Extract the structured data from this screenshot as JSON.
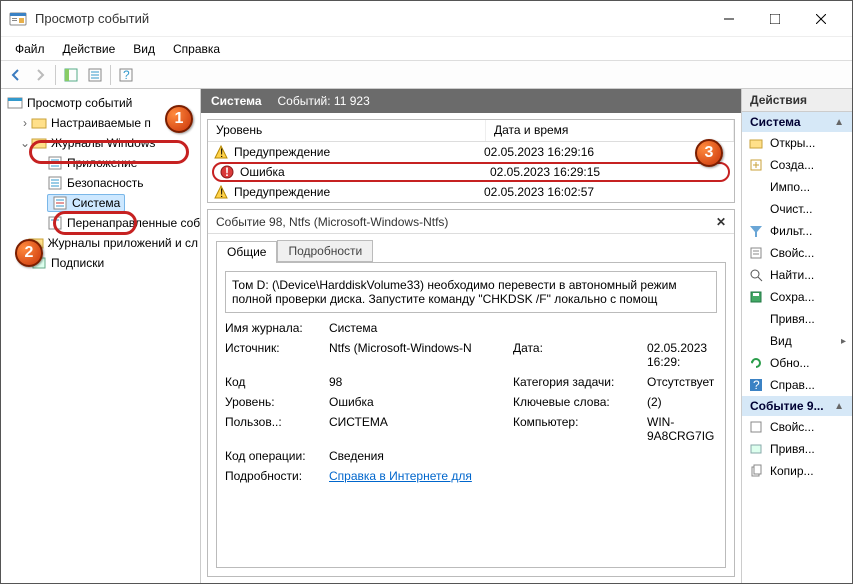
{
  "window": {
    "title": "Просмотр событий"
  },
  "menu": {
    "file": "Файл",
    "action": "Действие",
    "view": "Вид",
    "help": "Справка"
  },
  "tree": {
    "root": "Просмотр событий",
    "custom": "Настраиваемые п",
    "winlogs": "Журналы Windows",
    "app": "Приложение",
    "security": "Безопасность",
    "system": "Система",
    "forwarded": "Перенаправленные соб",
    "applogs": "Журналы приложений и сл",
    "subs": "Подписки"
  },
  "center": {
    "title": "Система",
    "count_label": "Событий: 11 923",
    "col_level": "Уровень",
    "col_date": "Дата и время",
    "rows": [
      {
        "level": "Предупреждение",
        "date": "02.05.2023 16:29:16",
        "type": "warn"
      },
      {
        "level": "Ошибка",
        "date": "02.05.2023 16:29:15",
        "type": "error"
      },
      {
        "level": "Предупреждение",
        "date": "02.05.2023 16:02:57",
        "type": "warn"
      }
    ],
    "detail_title": "Событие 98, Ntfs (Microsoft-Windows-Ntfs)",
    "tab_general": "Общие",
    "tab_details": "Подробности",
    "message": "Том D: (\\Device\\HarddiskVolume33) необходимо перевести в автономный режим полной проверки диска. Запустите команду \"CHKDSK /F\" локально с помощ",
    "props": {
      "log_lbl": "Имя журнала:",
      "log_val": "Система",
      "src_lbl": "Источник:",
      "src_val": "Ntfs (Microsoft-Windows-N",
      "date_lbl": "Дата:",
      "date_val": "02.05.2023 16:29:",
      "code_lbl": "Код",
      "code_val": "98",
      "cat_lbl": "Категория задачи:",
      "cat_val": "Отсутствует",
      "lvl_lbl": "Уровень:",
      "lvl_val": "Ошибка",
      "kw_lbl": "Ключевые слова:",
      "kw_val": "(2)",
      "user_lbl": "Пользов..:",
      "user_val": "СИСТЕМА",
      "comp_lbl": "Компьютер:",
      "comp_val": "WIN-9A8CRG7IG",
      "op_lbl": "Код операции:",
      "op_val": "Сведения",
      "info_lbl": "Подробности:",
      "info_link": "Справка в Интернете для"
    }
  },
  "actions": {
    "header": "Действия",
    "sec1": "Система",
    "open": "Откры...",
    "create": "Созда...",
    "import": "Импо...",
    "clear": "Очист...",
    "filter": "Фильт...",
    "props": "Свойс...",
    "find": "Найти...",
    "save": "Сохра...",
    "attach": "Привя...",
    "view": "Вид",
    "refresh": "Обно...",
    "help": "Справ...",
    "sec2": "Событие 9...",
    "evprops": "Свойс...",
    "evattach": "Привя...",
    "copy": "Копир..."
  }
}
